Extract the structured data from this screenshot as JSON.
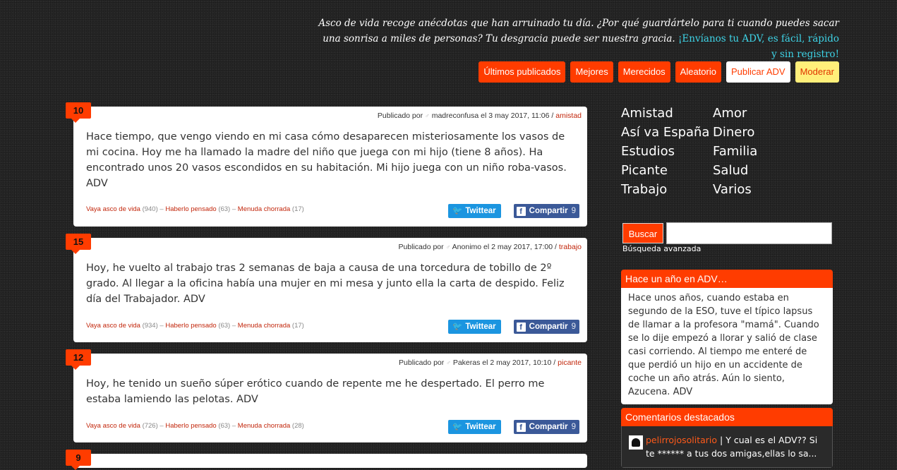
{
  "header": {
    "tagline": "Asco de vida recoge anécdotas que han arruinado tu día. ¿Por qué guardártelo para ti cuando puedes sacar una sonrisa a miles de personas? Tu desgracia puede ser nuestra gracia. ",
    "cta": "¡Envíanos tu ADV, es fácil, rápido y sin registro!"
  },
  "nav": [
    "Últimos publicados",
    "Mejores",
    "Merecidos",
    "Aleatorio",
    "Publicar ADV",
    "Moderar"
  ],
  "posts": [
    {
      "score": "10",
      "published_prefix": "Publicado por",
      "author": "madreconfusa",
      "date": "el 3 may 2017, 11:06",
      "category": "amistad",
      "text": "Hace tiempo, que vengo viendo en mi casa cómo desaparecen misteriosamente los vasos de mi cocina. Hoy me ha llamado la madre del niño que juega con mi hijo (tiene 8 años). Ha encontrado unos 20 vasos escondidos en su habitación. Mi hijo juega con un niño roba-vasos. ADV",
      "vote1_label": "Vaya asco de vida",
      "vote1_count": "(940)",
      "vote2_label": "Haberlo pensado",
      "vote2_count": "(63)",
      "vote3_label": "Menuda chorrada",
      "vote3_count": "(17)",
      "twitter": "Twittear",
      "facebook": "Compartir",
      "facebook_count": "9"
    },
    {
      "score": "15",
      "published_prefix": "Publicado por",
      "author": "Anonimo",
      "date": "el 2 may 2017, 17:00",
      "category": "trabajo",
      "text": "Hoy, he vuelto al trabajo tras 2 semanas de baja a causa de una torcedura de tobillo de 2º grado. Al llegar a la oficina había una mujer en mi mesa y junto ella la carta de despido. Feliz día del Trabajador. ADV",
      "vote1_label": "Vaya asco de vida",
      "vote1_count": "(934)",
      "vote2_label": "Haberlo pensado",
      "vote2_count": "(63)",
      "vote3_label": "Menuda chorrada",
      "vote3_count": "(17)",
      "twitter": "Twittear",
      "facebook": "Compartir",
      "facebook_count": "9"
    },
    {
      "score": "12",
      "published_prefix": "Publicado por",
      "author": "Pakeras",
      "date": "el 2 may 2017, 10:10",
      "category": "picante",
      "text": "Hoy, he tenido un sueño súper erótico cuando de repente me he despertado. El perro me estaba lamiendo las pelotas. ADV",
      "vote1_label": "Vaya asco de vida",
      "vote1_count": "(726)",
      "vote2_label": "Haberlo pensado",
      "vote2_count": "(63)",
      "vote3_label": "Menuda chorrada",
      "vote3_count": "(28)",
      "twitter": "Twittear",
      "facebook": "Compartir",
      "facebook_count": "9"
    }
  ],
  "next_score": "9",
  "categories": [
    "Amistad",
    "Amor",
    "Así va España",
    "Dinero",
    "Estudios",
    "Familia",
    "Picante",
    "Salud",
    "Trabajo",
    "Varios"
  ],
  "search": {
    "button": "Buscar",
    "advanced": "Búsqueda avanzada",
    "value": ""
  },
  "year_ago": {
    "title": "Hace un año en ADV…",
    "text": "Hace unos años, cuando estaba en segundo de la ESO, tuve el típico lapsus de llamar a la profesora \"mamá\". Cuando se lo dije empezó a llorar y salió de clase casi corriendo. Al tiempo me enteré de que perdió un hijo en un accidente de coche un año atrás. Aún lo siento, Azucena. ADV"
  },
  "featured_comments": {
    "title": "Comentarios destacados",
    "user": "pelirrojosolitario",
    "text": " | Y cual es el ADV?? Si te ****** a tus dos amigas,ellas lo sa..."
  },
  "colors": {
    "accent": "#ff3c00",
    "link_cyan": "#3ed3e6",
    "twitter": "#1b95e0",
    "facebook": "#3b5998",
    "moderate": "#ffef7a"
  }
}
